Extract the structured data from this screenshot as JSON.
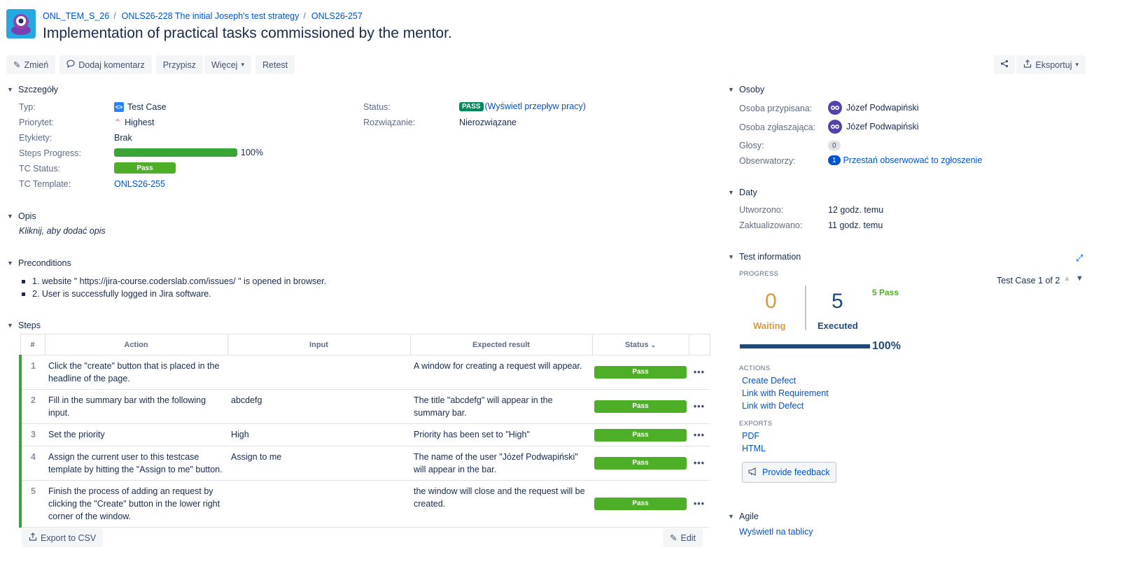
{
  "header": {
    "breadcrumb": [
      "ONL_TEM_S_26",
      "ONLS26-228 The initial Joseph's test strategy",
      "ONLS26-257"
    ],
    "separator": "/",
    "title": "Implementation of practical tasks commissioned by the mentor."
  },
  "toolbar": {
    "edit_label": "Zmień",
    "comment_label": "Dodaj komentarz",
    "assign_label": "Przypisz",
    "more_label": "Więcej",
    "retest_label": "Retest",
    "export_label": "Eksportuj"
  },
  "details": {
    "heading": "Szczegóły",
    "type_label": "Typ:",
    "type_value": "Test Case",
    "priority_label": "Priorytet:",
    "priority_value": "Highest",
    "labels_label": "Etykiety:",
    "labels_value": "Brak",
    "steps_progress_label": "Steps Progress:",
    "steps_progress_value": "100%",
    "steps_progress_fraction": 1.0,
    "tc_status_label": "TC Status:",
    "tc_status_value": "Pass",
    "tc_template_label": "TC Template:",
    "tc_template_value": "ONLS26-255",
    "status_label": "Status:",
    "status_value": "PASS",
    "status_link": "(Wyświetl przepływ pracy)",
    "resolution_label": "Rozwiązanie:",
    "resolution_value": "Nierozwiązane"
  },
  "description": {
    "heading": "Opis",
    "placeholder": "Kliknij, aby dodać opis"
  },
  "preconditions": {
    "heading": "Preconditions",
    "items": [
      "1. website \" https://jira-course.coderslab.com/issues/ \" is opened in browser.",
      "2. User is successfully logged in Jira software."
    ]
  },
  "steps": {
    "heading": "Steps",
    "columns": [
      "#",
      "Action",
      "Input",
      "Expected result",
      "Status"
    ],
    "rows": [
      {
        "num": "1",
        "action": "Click the \"create\" button that is placed in the headline of the page.",
        "input": "",
        "expected": "A window for creating a request will appear.",
        "status": "Pass"
      },
      {
        "num": "2",
        "action": "Fill in the summary bar with the following input.",
        "input": "abcdefg",
        "expected": "The title \"abcdefg\" will appear in the summary bar.",
        "status": "Pass"
      },
      {
        "num": "3",
        "action": "Set the priority",
        "input": "High",
        "expected": "Priority has been set to \"High\"",
        "status": "Pass"
      },
      {
        "num": "4",
        "action": "Assign the current user to this testcase template by hitting the \"Assign to me\" button.",
        "input": "Assign to me",
        "expected": "The name of the user \"Józef Podwapiński\" will appear in the bar.",
        "status": "Pass"
      },
      {
        "num": "5",
        "action": "Finish the process of adding an request by clicking the \"Create\" button in the lower right corner of the window.",
        "input": "",
        "expected": "the window will close and the request will be created.",
        "status": "Pass"
      }
    ],
    "more_glyph": "•••",
    "export_csv_label": "Export to CSV",
    "edit_label": "Edit"
  },
  "people": {
    "heading": "Osoby",
    "assignee_label": "Osoba przypisana:",
    "assignee_value": "Józef Podwapiński",
    "reporter_label": "Osoba zgłaszająca:",
    "reporter_value": "Józef Podwapiński",
    "votes_label": "Głosy:",
    "votes_value": "0",
    "watchers_label": "Obserwatorzy:",
    "watchers_count": "1",
    "watchers_link": "Przestań obserwować to zgłoszenie"
  },
  "dates": {
    "heading": "Daty",
    "created_label": "Utworzono:",
    "created_value": "12 godz. temu",
    "updated_label": "Zaktualizowano:",
    "updated_value": "11 godz. temu"
  },
  "test_info": {
    "heading": "Test information",
    "progress_caption": "PROGRESS",
    "waiting_count": "0",
    "waiting_label": "Waiting",
    "executed_count": "5",
    "executed_label": "Executed",
    "pass_summary": "5 Pass",
    "percent": "100%",
    "pager": "Test Case 1 of 2",
    "actions_caption": "ACTIONS",
    "actions": [
      "Create Defect",
      "Link with Requirement",
      "Link with Defect"
    ],
    "exports_caption": "EXPORTS",
    "exports": [
      "PDF",
      "HTML"
    ],
    "feedback_label": "Provide feedback"
  },
  "agile": {
    "heading": "Agile",
    "link": "Wyświetl na tablicy"
  },
  "colors": {
    "pass_green": "#4caf27",
    "link_blue": "#0052cc",
    "waiting_orange": "#d39c3f",
    "executed_navy": "#1e4a7a"
  }
}
